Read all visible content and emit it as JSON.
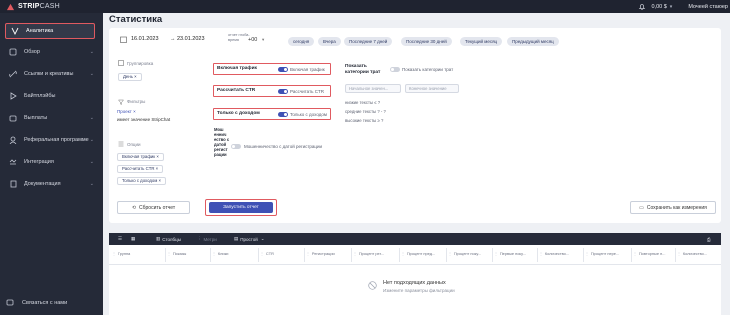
{
  "app": {
    "logo_main": "STRIP",
    "logo_sub": "CASH",
    "balance": "0,00 $",
    "user": "Мочеей стаюер"
  },
  "sidebar": {
    "items": [
      {
        "label": "Аналитика",
        "icon": "analytics-icon",
        "active": true
      },
      {
        "label": "Обзор",
        "icon": "overview-icon"
      },
      {
        "label": "Ссылки и креативы",
        "icon": "link-icon"
      },
      {
        "label": "Байтплэйбы",
        "icon": "play-icon"
      },
      {
        "label": "Выплаты",
        "icon": "wallet-icon"
      },
      {
        "label": "Реферальная программе",
        "icon": "referral-icon"
      },
      {
        "label": "Интеграция",
        "icon": "integration-icon"
      },
      {
        "label": "Документация",
        "icon": "docs-icon"
      }
    ],
    "contact": "Связаться с нами"
  },
  "page": {
    "title": "Статистика"
  },
  "filters": {
    "date_from": "16.01.2023",
    "date_to": "23.01.2023",
    "tz_label": "отчет глоба- время",
    "tz_value": "+00",
    "quick_ranges": [
      "сегодня",
      "Вчера",
      "Последние 7 дней",
      "Последние 30 дней",
      "Текущий месяц",
      "Предыдущий месяц"
    ],
    "grouping_label": "Группировка",
    "grouping_chip": "День",
    "filters_label": "Фильтры",
    "project_label": "Проект",
    "project_value": "имеет значение StripChat",
    "options_label": "Опции",
    "option_chips": [
      "Включая трафик",
      "Рассчитать CTR",
      "Только с доходом"
    ],
    "toggles": [
      {
        "label": "Включая трафик",
        "option": "Включая трафик",
        "on": true
      },
      {
        "label": "Рассчитать CTR",
        "option": "Рассчитать CTR",
        "on": true
      },
      {
        "label": "Только с доходом",
        "option": "Только с доходом",
        "on": true
      }
    ],
    "mosh_label": "Мош еннич ество с датой регист рации",
    "mosh_option": "Мошенничество с датой регистрации",
    "categories_label": "Показать категории трат",
    "categories_option": "Показать категории трат",
    "input_from": "Начальное значен...",
    "input_to": "Конечное значение",
    "metrics": [
      "низкие тексты ≤ ?",
      "средние тексты ? - ?",
      "высокие тексты ≥ ?"
    ],
    "reset_label": "Сбросить отчет",
    "run_label": "Запустить отчет",
    "save_label": "Сохранить как измерения"
  },
  "table": {
    "columns_label": "Столбцы",
    "metrics_label": "Метри",
    "view_value": "Простой",
    "headers": [
      "Группа",
      "Показы",
      "Клики",
      "CTR",
      "Регистрации",
      "Процент рег...",
      "Процент пред...",
      "Процент поку...",
      "Первые поку...",
      "Количество...",
      "Процент пере...",
      "Повторные п...",
      "Количество..."
    ],
    "empty_title": "Нет подходящих данных",
    "empty_subtitle": "Измените параметры фильтрации"
  },
  "colors": {
    "sidebar": "#252a38",
    "accent": "#3f51b5",
    "highlight": "#e05a60"
  }
}
